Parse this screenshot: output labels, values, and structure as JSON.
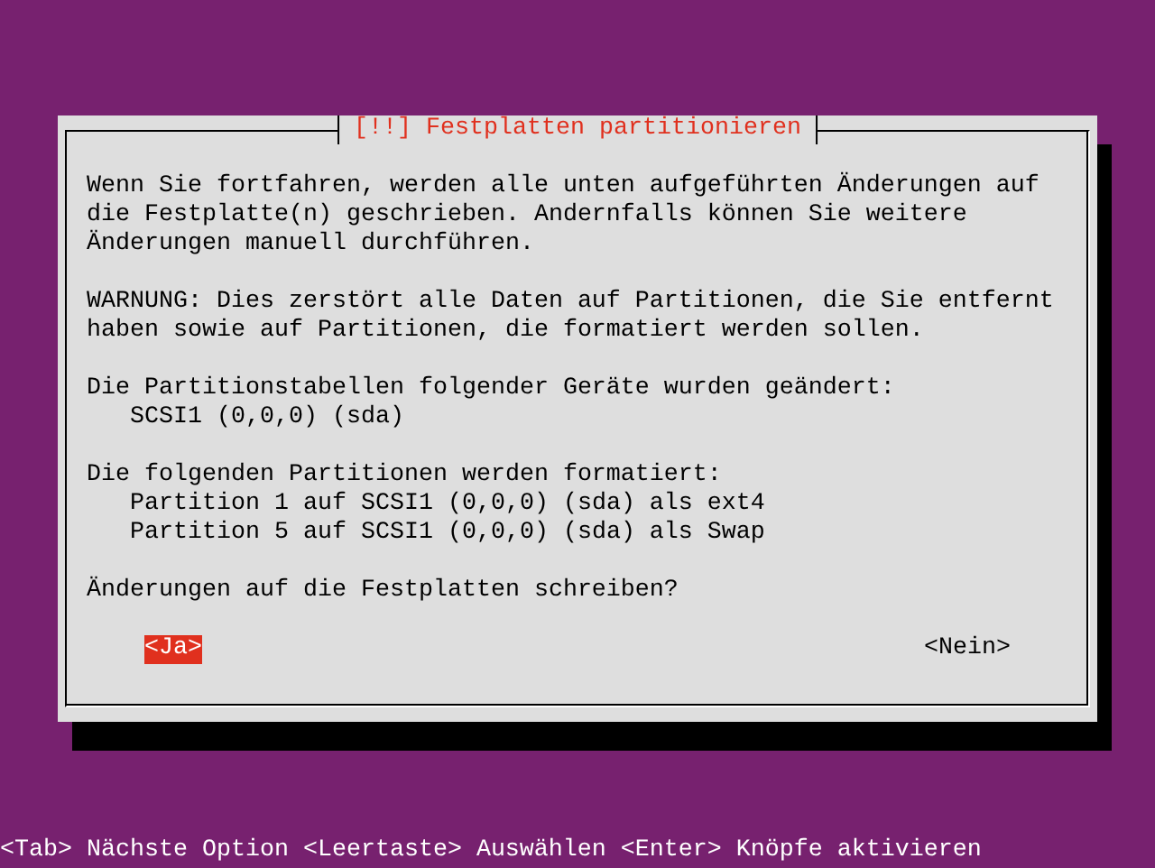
{
  "dialog": {
    "title": "[!!] Festplatten partitionieren",
    "blocks": [
      {
        "kind": "text",
        "text": "Wenn Sie fortfahren, werden alle unten aufgeführten Änderungen auf\ndie Festplatte(n) geschrieben. Andernfalls können Sie weitere\nÄnderungen manuell durchführen."
      },
      {
        "kind": "text",
        "text": "WARNUNG: Dies zerstört alle Daten auf Partitionen, die Sie entfernt\nhaben sowie auf Partitionen, die formatiert werden sollen."
      },
      {
        "kind": "text",
        "text": "Die Partitionstabellen folgender Geräte wurden geändert:"
      },
      {
        "kind": "list",
        "items": [
          "SCSI1 (0,0,0) (sda)"
        ]
      },
      {
        "kind": "text",
        "text": "Die folgenden Partitionen werden formatiert:"
      },
      {
        "kind": "list",
        "items": [
          "Partition 1 auf SCSI1 (0,0,0) (sda) als ext4",
          "Partition 5 auf SCSI1 (0,0,0) (sda) als Swap"
        ]
      },
      {
        "kind": "text",
        "text": "Änderungen auf die Festplatten schreiben?"
      }
    ],
    "buttons": [
      {
        "label": "<Ja>",
        "selected": true
      },
      {
        "label": "<Nein>",
        "selected": false
      }
    ]
  },
  "status_bar": "<Tab> Nächste Option <Leertaste> Auswählen <Enter> Knöpfe aktivieren"
}
